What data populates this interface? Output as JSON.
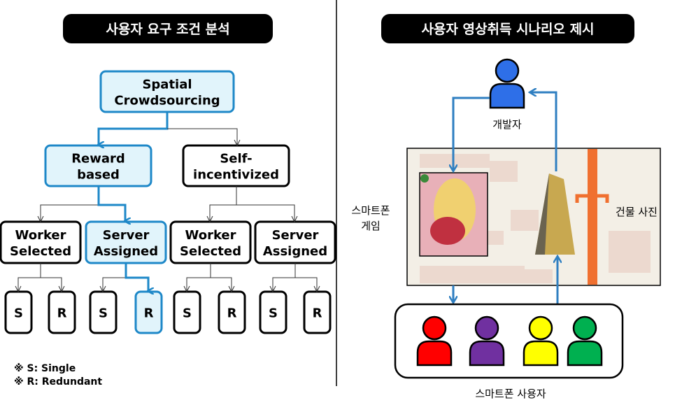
{
  "left": {
    "title": "사용자 요구 조건 분석",
    "root": [
      "Spatial",
      "Crowdsourcing"
    ],
    "level2": [
      [
        "Reward",
        "based"
      ],
      [
        "Self-",
        "incentivized"
      ]
    ],
    "level3": [
      [
        "Worker",
        "Selected"
      ],
      [
        "Server",
        "Assigned"
      ],
      [
        "Worker",
        "Selected"
      ],
      [
        "Server",
        "Assigned"
      ]
    ],
    "leaves": [
      "S",
      "R",
      "S",
      "R",
      "S",
      "R",
      "S",
      "R"
    ],
    "notes": [
      "※ S: Single",
      "※ R:  Redundant"
    ]
  },
  "right": {
    "title": "사용자 영상취득 시나리오 제시",
    "developer_label": "개발자",
    "game_label": [
      "스마트폰",
      "게임"
    ],
    "building_label": "건물 사진",
    "users_label": "스마트폰 사용자",
    "user_colors": [
      "#ff0000",
      "#7030a0",
      "#ffff00",
      "#00b050"
    ],
    "developer_color": "#2e6fe8"
  },
  "colors": {
    "highlight_border": "#1e88c8",
    "highlight_fill": "#e1f4fb",
    "arrow": "#2f7fc1"
  }
}
